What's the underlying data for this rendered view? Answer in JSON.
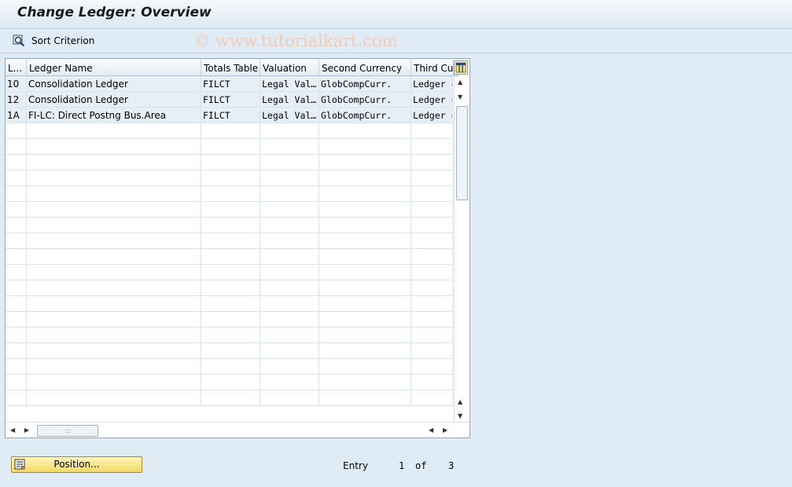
{
  "window": {
    "title": "Change Ledger: Overview"
  },
  "watermark": "© www.tutorialkart.com",
  "toolbar": {
    "sort_label": "Sort Criterion"
  },
  "table": {
    "headers": [
      "L...",
      "Ledger Name",
      "Totals Table",
      "Valuation",
      "Second Currency",
      "Third Cur"
    ],
    "rows": [
      [
        "10",
        "Consolidation Ledger",
        "FILCT",
        "Legal Val…",
        "GlobCompCurr.",
        "Ledger c"
      ],
      [
        "12",
        "Consolidation Ledger",
        "FILCT",
        "Legal Val…",
        "GlobCompCurr.",
        "Ledger c"
      ],
      [
        "1A",
        "FI-LC: Direct Postng Bus.Area",
        "FILCT",
        "Legal Val…",
        "GlobCompCurr.",
        "Ledger c"
      ]
    ],
    "empty_rows": 18
  },
  "footer": {
    "position_label": "Position...",
    "entry_label": "Entry",
    "entry_current": "1",
    "of_label": "of",
    "entry_total": "3"
  }
}
